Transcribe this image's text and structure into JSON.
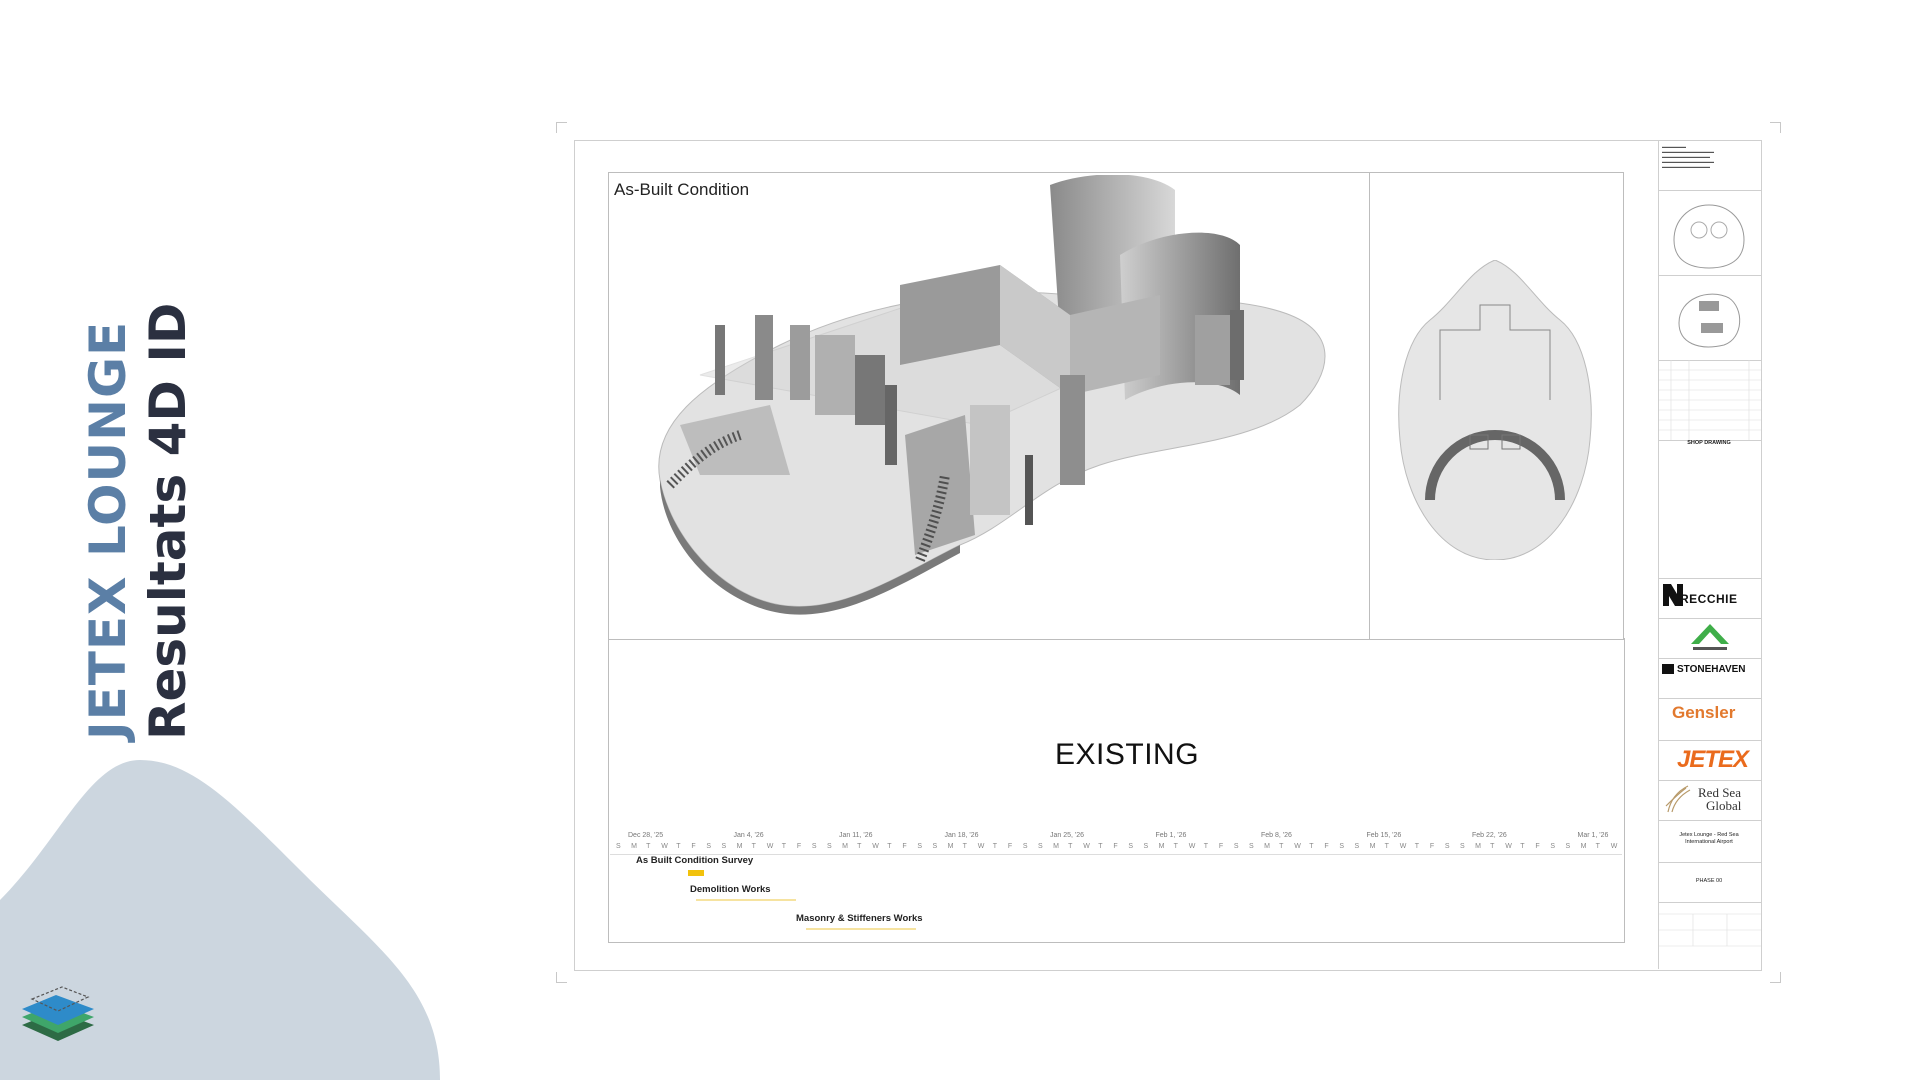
{
  "brand": {
    "title_line1": "JETEX LOUNGE",
    "title_line2": "Resultats 4D ID"
  },
  "drawing": {
    "view_title": "As-Built Condition",
    "state_label": "EXISTING"
  },
  "gantt": {
    "week_labels": [
      "Dec 28, '25",
      "Jan 4, '26",
      "Jan 11, '26",
      "Jan 18, '26",
      "Jan 25, '26",
      "Feb 1, '26",
      "Feb 8, '26",
      "Feb 15, '26",
      "Feb 22, '26",
      "Mar 1, '26"
    ],
    "day_letters": [
      "S",
      "M",
      "T",
      "W",
      "T",
      "F",
      "S"
    ],
    "tasks": [
      {
        "name": "As Built Condition Survey"
      },
      {
        "name": "Demolition Works"
      },
      {
        "name": "Masonry & Stiffeners Works"
      }
    ],
    "bar_color": "#f2c20c"
  },
  "title_block": {
    "sheet_type": "SHOP DRAWING",
    "contractor": "RECCHIE",
    "consultant": "STONEHAVEN",
    "designer": "Gensler",
    "client": "JETEX",
    "owner_line1": "Red Sea",
    "owner_line2": "Global",
    "project_line1": "Jetex Lounge - Red Sea",
    "project_line2": "International Airport",
    "phase": "PHASE 00"
  },
  "colors": {
    "brand_blue": "#5b7fa6",
    "brand_dark": "#2b3040",
    "blob": "#cdd6de",
    "gensler_orange": "#e2792e",
    "jetex_orange": "#ea6b1d"
  }
}
